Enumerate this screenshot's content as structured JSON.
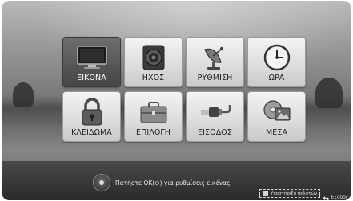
{
  "menu": {
    "tiles": [
      {
        "label": "ΕΙΚΟΝΑ",
        "icon": "tv-icon",
        "selected": true
      },
      {
        "label": "ΗΧΟΣ",
        "icon": "speaker-icon",
        "selected": false
      },
      {
        "label": "ΡΥΘΜΙΣΗ",
        "icon": "satellite-dish-icon",
        "selected": false
      },
      {
        "label": "ΩΡΑ",
        "icon": "clock-icon",
        "selected": false
      },
      {
        "label": "ΚΛΕΙΔΩΜΑ",
        "icon": "padlock-icon",
        "selected": false
      },
      {
        "label": "ΕΠΙΛΟΓΗ",
        "icon": "briefcase-icon",
        "selected": false
      },
      {
        "label": "ΕΙΣΟΔΟΣ",
        "icon": "cable-plug-icon",
        "selected": false
      },
      {
        "label": "ΜΕΣΑ",
        "icon": "media-icon",
        "selected": false
      }
    ]
  },
  "footer": {
    "hint_text": "Πατήστε ΟΚ(⊙) για ρυθμίσεις εικόνας.",
    "support_text": "Υποστήριξη πελατών",
    "exit_text": "Έξοδος"
  }
}
